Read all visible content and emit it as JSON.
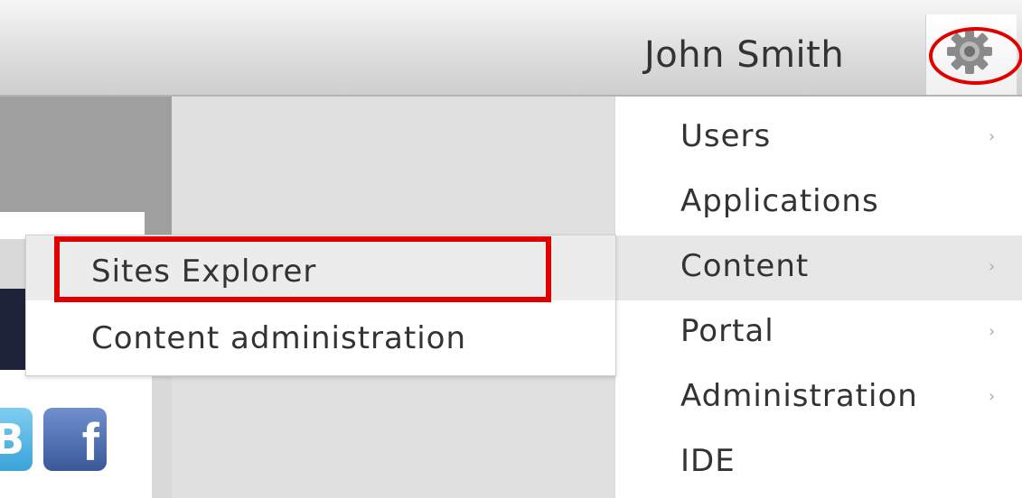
{
  "header": {
    "user_name": "John Smith",
    "settings_icon": "gear-icon"
  },
  "menu": {
    "items": [
      {
        "label": "Users",
        "has_submenu": true
      },
      {
        "label": "Applications",
        "has_submenu": false
      },
      {
        "label": "Content",
        "has_submenu": true
      },
      {
        "label": "Portal",
        "has_submenu": true
      },
      {
        "label": "Administration",
        "has_submenu": true
      },
      {
        "label": "IDE",
        "has_submenu": false
      }
    ],
    "arrow": "›"
  },
  "submenu": {
    "items": [
      {
        "label": "Sites Explorer"
      },
      {
        "label": "Content administration"
      }
    ]
  },
  "social": {
    "twitter_glyph": "B",
    "facebook_glyph": "f"
  },
  "colors": {
    "highlight": "#e00000",
    "active_row": "#e7e7e7",
    "navy": "#1f2339"
  }
}
